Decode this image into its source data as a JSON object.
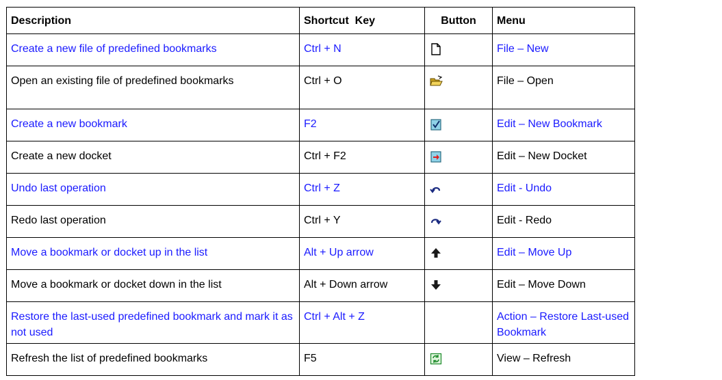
{
  "headers": {
    "description": "Description",
    "shortcut": "Shortcut  Key",
    "button": "Button",
    "menu": "Menu"
  },
  "rows": [
    {
      "description": "Create a new file of predefined bookmarks",
      "shortcut": "Ctrl + N",
      "icon": "new-file-icon",
      "menu": "File – New",
      "link": true
    },
    {
      "description": "Open an existing file of predefined bookmarks",
      "shortcut": "Ctrl + O",
      "icon": "open-folder-icon",
      "menu": "File – Open",
      "link": false
    },
    {
      "description": "Create a new bookmark",
      "shortcut": "F2",
      "icon": "new-bookmark-icon",
      "menu": "Edit – New Bookmark",
      "link": true
    },
    {
      "description": "Create a new docket",
      "shortcut": "Ctrl + F2",
      "icon": "new-docket-icon",
      "menu": "Edit – New Docket",
      "link": false
    },
    {
      "description": "Undo last operation",
      "shortcut": "Ctrl + Z",
      "icon": "undo-icon",
      "menu": "Edit - Undo",
      "link": true
    },
    {
      "description": "Redo last operation",
      "shortcut": "Ctrl + Y",
      "icon": "redo-icon",
      "menu": "Edit - Redo",
      "link": false
    },
    {
      "description": "Move a bookmark or docket up in the list",
      "shortcut": "Alt + Up arrow",
      "icon": "arrow-up-icon",
      "menu": "Edit – Move Up",
      "link": true
    },
    {
      "description": "Move a bookmark or docket down in the list",
      "shortcut": "Alt + Down arrow",
      "icon": "arrow-down-icon",
      "menu": "Edit – Move Down",
      "link": false
    },
    {
      "description": "Restore the last-used predefined bookmark and mark it as not used",
      "shortcut": "Ctrl + Alt + Z",
      "icon": "",
      "menu": "Action – Restore Last-used Bookmark",
      "link": true
    },
    {
      "description": "Refresh the list of predefined bookmarks",
      "shortcut": "F5",
      "icon": "refresh-icon",
      "menu": "View – Refresh",
      "link": false
    }
  ],
  "colors": {
    "link": "#1a1aff",
    "text": "#000000",
    "border": "#000000"
  }
}
